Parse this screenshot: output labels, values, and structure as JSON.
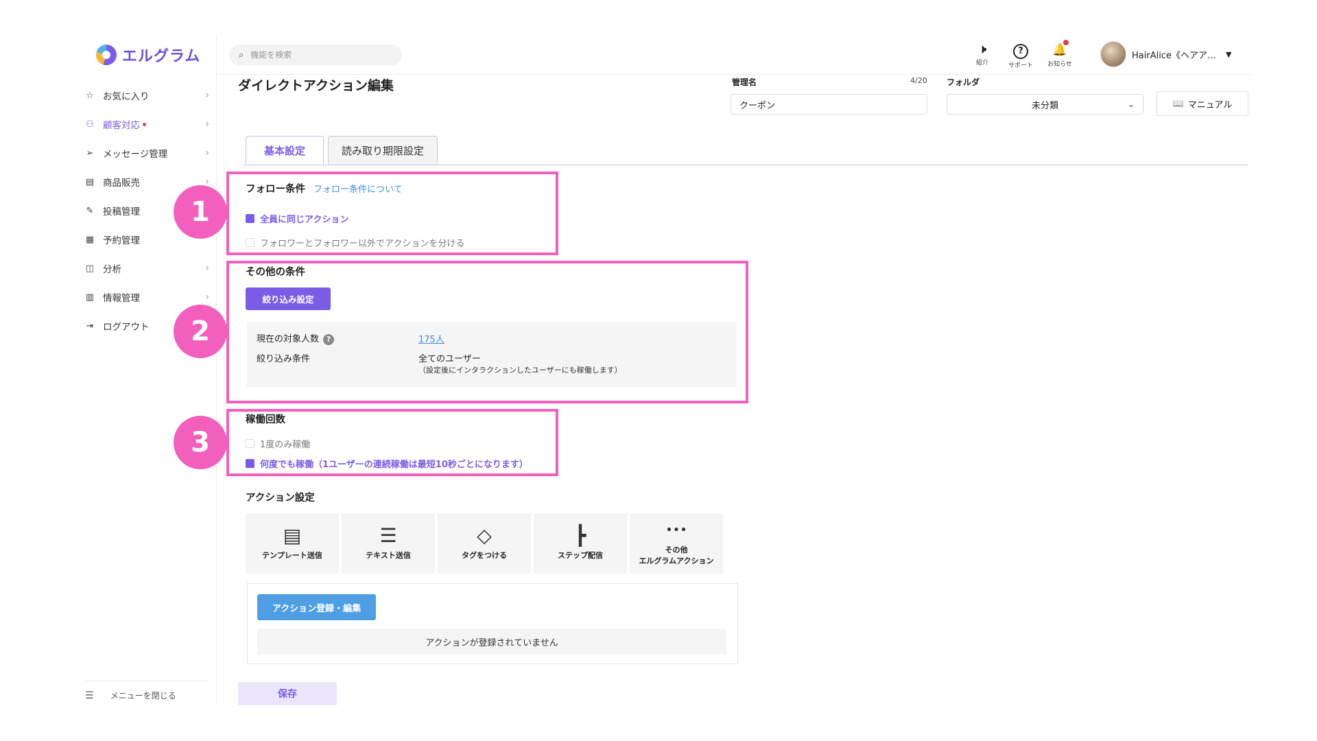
{
  "logo": {
    "text": "エルグラム"
  },
  "sidebar": {
    "items": [
      {
        "label": "お気に入り",
        "icon": "☆",
        "chevron": true,
        "active": false
      },
      {
        "label": "顧客対応",
        "icon": "⚇",
        "chevron": true,
        "active": true
      },
      {
        "label": "メッセージ管理",
        "icon": "➢",
        "chevron": true,
        "active": false
      },
      {
        "label": "商品販売",
        "icon": "▤",
        "chevron": true,
        "active": false
      },
      {
        "label": "投稿管理",
        "icon": "✎",
        "chevron": false,
        "active": false
      },
      {
        "label": "予約管理",
        "icon": "▦",
        "chevron": false,
        "active": false
      },
      {
        "label": "分析",
        "icon": "◫",
        "chevron": true,
        "active": false
      },
      {
        "label": "情報管理",
        "icon": "▥",
        "chevron": true,
        "active": false
      },
      {
        "label": "ログアウト",
        "icon": "⇥",
        "chevron": false,
        "active": false
      }
    ],
    "close_label": "メニューを閉じる"
  },
  "header": {
    "search_placeholder": "機能を検索",
    "icons": [
      {
        "label": "紹介",
        "glyph": "🕨"
      },
      {
        "label": "サポート",
        "glyph": "?"
      },
      {
        "label": "お知らせ",
        "glyph": "🔔"
      }
    ],
    "user_name": "HairAlice《ヘアア…"
  },
  "page": {
    "title": "ダイレクトアクション編集",
    "name_label": "管理名",
    "name_counter": "4/20",
    "name_value": "クーポン",
    "folder_label": "フォルダ",
    "folder_value": "未分類",
    "manual_label": "マニュアル"
  },
  "tabs": [
    {
      "label": "基本設定"
    },
    {
      "label": "読み取り期限設定"
    }
  ],
  "follow": {
    "title": "フォロー条件",
    "link": "フォロー条件について",
    "option_all": "全員に同じアクション",
    "option_split": "フォロワーとフォロワー以外でアクションを分ける"
  },
  "other": {
    "title": "その他の条件",
    "filter_button": "絞り込み設定",
    "count_label": "現在の対象人数",
    "count_value": "175人",
    "cond_label": "絞り込み条件",
    "cond_value": "全てのユーザー",
    "cond_note": "（設定後にインタラクションしたユーザーにも稼働します）"
  },
  "runs": {
    "title": "稼働回数",
    "option_once": "1度のみ稼働",
    "option_many": "何度でも稼働（1ユーザーの連続稼働は最短10秒ごとになります）"
  },
  "badges": [
    "1",
    "2",
    "3"
  ],
  "actions": {
    "title": "アクション設定",
    "tiles": [
      {
        "label": "テンプレート送信",
        "glyph": "▤"
      },
      {
        "label": "テキスト送信",
        "glyph": "☰"
      },
      {
        "label": "タグをつける",
        "glyph": "◇"
      },
      {
        "label": "ステップ配信",
        "glyph": "┣"
      },
      {
        "label": "その他\nエルグラムアクション",
        "glyph": "•••"
      }
    ],
    "register_button": "アクション登録・編集",
    "empty_message": "アクションが登録されていません"
  },
  "save_label": "保存",
  "colors": {
    "accent": "#7b5ce6",
    "highlight": "#f25fbd",
    "link": "#3d8fe8",
    "button_blue": "#4e9ee4"
  }
}
